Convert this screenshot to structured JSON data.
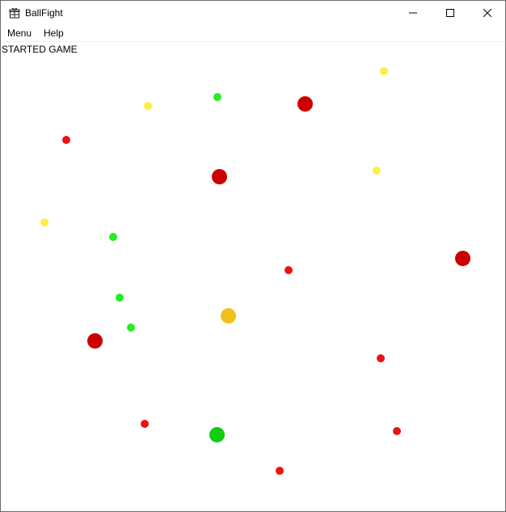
{
  "window": {
    "title": "BallFight",
    "icon": "app-gift-icon",
    "controls": [
      "minimize-icon",
      "maximize-icon",
      "close-icon"
    ]
  },
  "menu": {
    "items": [
      {
        "label": "Menu"
      },
      {
        "label": "Help"
      }
    ]
  },
  "game": {
    "status": "STARTED GAME",
    "colors": {
      "green": "#22ee22",
      "yellow": "#ffee44",
      "red": "#ee1111",
      "dark_red": "#cc0000",
      "big_yellow": "#f2c01c",
      "big_green": "#11cc11"
    },
    "balls": [
      {
        "color": "yellow",
        "size": "small"
      },
      {
        "color": "green",
        "size": "small"
      },
      {
        "color": "yellow",
        "size": "small"
      },
      {
        "color": "dark_red",
        "size": "large"
      },
      {
        "color": "red",
        "size": "small"
      },
      {
        "color": "dark_red",
        "size": "large"
      },
      {
        "color": "yellow",
        "size": "small"
      },
      {
        "color": "yellow",
        "size": "small"
      },
      {
        "color": "green",
        "size": "small"
      },
      {
        "color": "dark_red",
        "size": "large"
      },
      {
        "color": "red",
        "size": "small"
      },
      {
        "color": "green",
        "size": "small"
      },
      {
        "color": "big_yellow",
        "size": "large"
      },
      {
        "color": "green",
        "size": "small"
      },
      {
        "color": "dark_red",
        "size": "large"
      },
      {
        "color": "red",
        "size": "small"
      },
      {
        "color": "red",
        "size": "small"
      },
      {
        "color": "big_green",
        "size": "large"
      },
      {
        "color": "red",
        "size": "small"
      },
      {
        "color": "red",
        "size": "small"
      }
    ]
  }
}
